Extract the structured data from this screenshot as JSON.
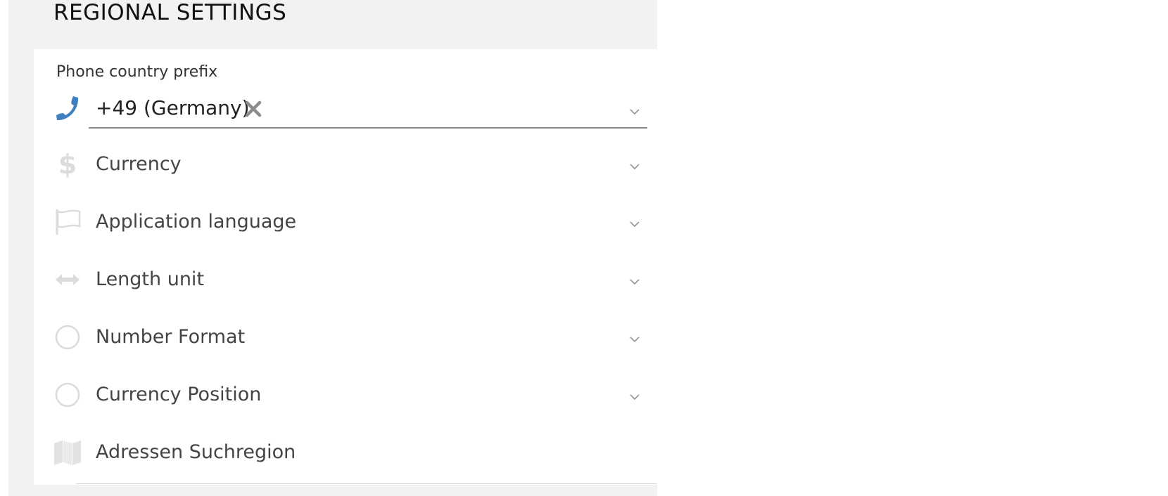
{
  "section": {
    "title": "REGIONAL SETTINGS"
  },
  "phone": {
    "label": "Phone country prefix",
    "value": "+49 (Germany)",
    "icon": "phone-icon",
    "clear_icon": "close-icon"
  },
  "fields": {
    "currency": {
      "placeholder": "Currency",
      "icon": "dollar-icon"
    },
    "language": {
      "placeholder": "Application language",
      "icon": "flag-icon"
    },
    "length": {
      "placeholder": "Length unit",
      "icon": "arrows-horizontal-icon"
    },
    "number_format": {
      "placeholder": "Number Format",
      "icon": "circle-icon"
    },
    "currency_position": {
      "placeholder": "Currency Position",
      "icon": "circle-icon"
    },
    "address_region": {
      "placeholder": "Adressen Suchregion",
      "icon": "map-icon"
    }
  },
  "colors": {
    "accent": "#3d7fc1",
    "panel_bg": "#f2f2f2",
    "icon_muted": "#dcdcdc",
    "chevron": "#9a9a9a"
  }
}
